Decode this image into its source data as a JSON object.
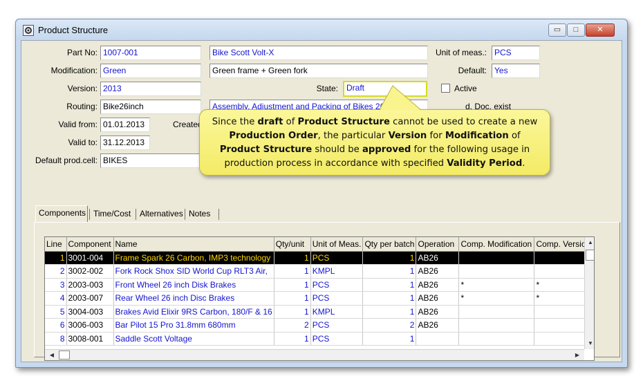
{
  "window": {
    "title": "Product Structure",
    "min_glyph": "▭",
    "max_glyph": "□",
    "close_glyph": "✕"
  },
  "form": {
    "part_no": {
      "label": "Part No:",
      "value": "1007-001",
      "description": "Bike Scott Volt-X"
    },
    "modification": {
      "label": "Modification:",
      "value": "Green",
      "description": "Green frame + Green fork"
    },
    "version": {
      "label": "Version:",
      "value": "2013"
    },
    "state": {
      "label": "State:",
      "value": "Draft"
    },
    "routing": {
      "label": "Routing:",
      "value": "Bike26inch",
      "description": "Assembly, Adjustment and Packing of Bikes 26 inch"
    },
    "valid_from": {
      "label": "Valid from:",
      "value": "01.01.2013"
    },
    "created_label": "Created",
    "valid_to": {
      "label": "Valid to:",
      "value": "31.12.2013"
    },
    "default_prod_cell": {
      "label": "Default prod.cell:",
      "value": "BIKES"
    },
    "unit_of_meas": {
      "label": "Unit of meas.:",
      "value": "PCS"
    },
    "default": {
      "label": "Default:",
      "value": "Yes"
    },
    "active": {
      "label": "Active"
    },
    "doc_exist": {
      "label": "d. Doc. exist"
    }
  },
  "callout": {
    "parts": [
      {
        "t": "Since the ",
        "b": false
      },
      {
        "t": "draft",
        "b": true
      },
      {
        "t": " of ",
        "b": false
      },
      {
        "t": "Product Structure",
        "b": true
      },
      {
        "t": " cannot be used to create a new ",
        "b": false
      },
      {
        "t": "Production Order",
        "b": true
      },
      {
        "t": ", the particular ",
        "b": false
      },
      {
        "t": "Version",
        "b": true
      },
      {
        "t": " for ",
        "b": false
      },
      {
        "t": "Modification",
        "b": true
      },
      {
        "t": " of ",
        "b": false
      },
      {
        "t": "Product Structure",
        "b": true
      },
      {
        "t": " should be ",
        "b": false
      },
      {
        "t": "approved",
        "b": true
      },
      {
        "t": " for the following usage in production process in accordance with specified ",
        "b": false
      },
      {
        "t": "Validity Period",
        "b": true
      },
      {
        "t": ".",
        "b": false
      }
    ]
  },
  "tabs": [
    "Components",
    "Time/Cost",
    "Alternatives",
    "Notes"
  ],
  "grid": {
    "columns": [
      "Line",
      "Component",
      "Name",
      "Qty/unit",
      "Unit of Meas.",
      "Qty per batch",
      "Operation",
      "Comp. Modification",
      "Comp. Version"
    ],
    "rows": [
      {
        "line": "1",
        "component": "3001-004",
        "name": "Frame Spark 26 Carbon, IMP3 technology",
        "qty_unit": "1",
        "uom": "PCS",
        "qty_batch": "1",
        "operation": "AB26",
        "comp_mod": "",
        "comp_ver": "",
        "selected": true
      },
      {
        "line": "2",
        "component": "3002-002",
        "name": "Fork Rock Shox SID World Cup RLT3 Air,",
        "qty_unit": "1",
        "uom": "KMPL",
        "qty_batch": "1",
        "operation": "AB26",
        "comp_mod": "",
        "comp_ver": "",
        "selected": false
      },
      {
        "line": "3",
        "component": "2003-003",
        "name": "Front Wheel 26 inch Disk Brakes",
        "qty_unit": "1",
        "uom": "PCS",
        "qty_batch": "1",
        "operation": "AB26",
        "comp_mod": "*",
        "comp_ver": "*",
        "selected": false
      },
      {
        "line": "4",
        "component": "2003-007",
        "name": "Rear Wheel 26 inch Disc Brakes",
        "qty_unit": "1",
        "uom": "PCS",
        "qty_batch": "1",
        "operation": "AB26",
        "comp_mod": "*",
        "comp_ver": "*",
        "selected": false
      },
      {
        "line": "5",
        "component": "3004-003",
        "name": "Brakes Avid Elixir 9RS Carbon, 180/F & 16",
        "qty_unit": "1",
        "uom": "KMPL",
        "qty_batch": "1",
        "operation": "AB26",
        "comp_mod": "",
        "comp_ver": "",
        "selected": false
      },
      {
        "line": "6",
        "component": "3006-003",
        "name": "Bar Pilot 15 Pro 31.8mm 680mm",
        "qty_unit": "2",
        "uom": "PCS",
        "qty_batch": "2",
        "operation": "AB26",
        "comp_mod": "",
        "comp_ver": "",
        "selected": false
      },
      {
        "line": "8",
        "component": "3008-001",
        "name": "Saddle Scott Voltage",
        "qty_unit": "1",
        "uom": "PCS",
        "qty_batch": "1",
        "operation": "",
        "comp_mod": "",
        "comp_ver": "",
        "selected": false
      }
    ]
  },
  "colors": {
    "callout_bg": "#f7f07e",
    "highlight_border": "#d4dc1c",
    "blue_text": "#1515d0",
    "selected_text": "#ffd700"
  }
}
